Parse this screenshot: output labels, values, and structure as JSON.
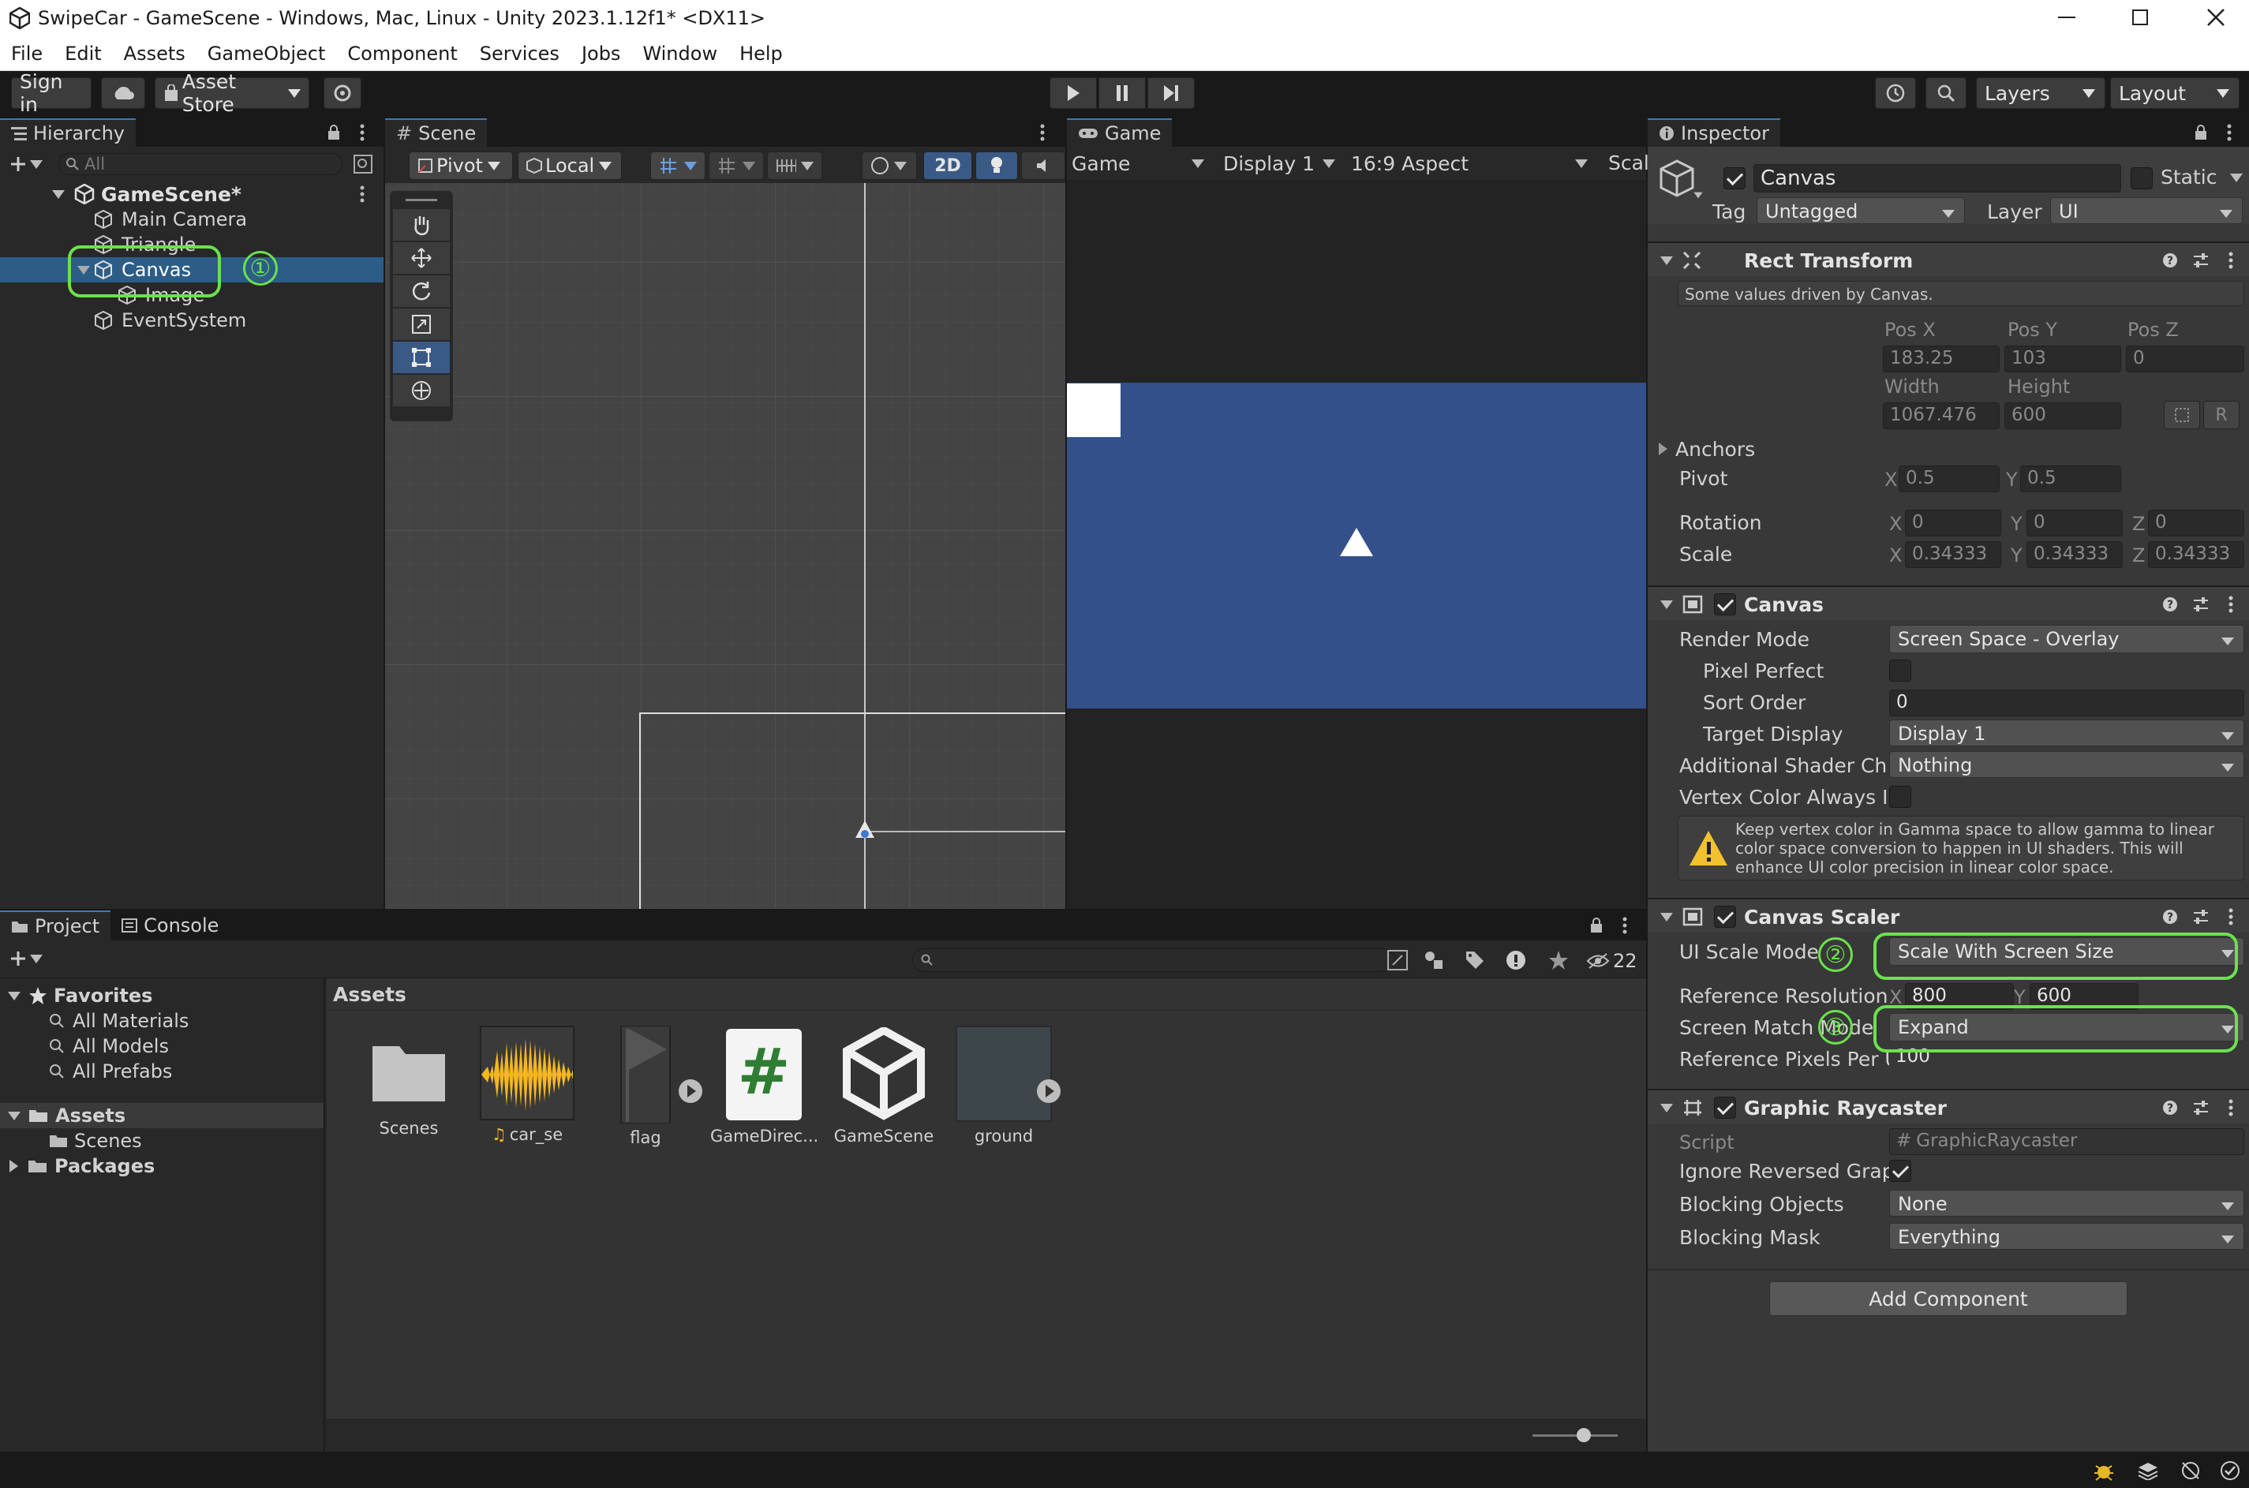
{
  "window": {
    "title": "SwipeCar - GameScene - Windows, Mac, Linux - Unity 2023.1.12f1* <DX11>"
  },
  "menu": [
    "File",
    "Edit",
    "Assets",
    "GameObject",
    "Component",
    "Services",
    "Jobs",
    "Window",
    "Help"
  ],
  "toolbar": {
    "sign_in": "Sign in",
    "asset_store": "Asset Store",
    "layers": "Layers",
    "layout": "Layout"
  },
  "hierarchy": {
    "tab": "Hierarchy",
    "search_placeholder": "All",
    "scene": "GameScene*",
    "items": [
      "Main Camera",
      "Triangle",
      "Canvas",
      "Image",
      "EventSystem"
    ]
  },
  "scene": {
    "tab": "Scene",
    "pivot": "Pivot",
    "local": "Local",
    "mode_2d": "2D"
  },
  "game": {
    "tab": "Game",
    "view": "Game",
    "display": "Display 1",
    "aspect": "16:9 Aspect",
    "scale": "Scal"
  },
  "project": {
    "tabs": [
      "Project",
      "Console"
    ],
    "hidden_count": "22",
    "favorites": "Favorites",
    "favorite_items": [
      "All Materials",
      "All Models",
      "All Prefabs"
    ],
    "assets": "Assets",
    "asset_folders": [
      "Scenes"
    ],
    "packages": "Packages",
    "breadcrumb": "Assets",
    "files": [
      "Scenes",
      "car_se",
      "flag",
      "GameDirec...",
      "GameScene",
      "ground"
    ]
  },
  "inspector": {
    "tab": "Inspector",
    "object_name": "Canvas",
    "static": "Static",
    "tag_label": "Tag",
    "tag": "Untagged",
    "layer_label": "Layer",
    "layer": "UI",
    "rect_transform": {
      "title": "Rect Transform",
      "note": "Some values driven by Canvas.",
      "pos_x_label": "Pos X",
      "pos_y_label": "Pos Y",
      "pos_z_label": "Pos Z",
      "pos_x": "183.25",
      "pos_y": "103",
      "pos_z": "0",
      "width_label": "Width",
      "height_label": "Height",
      "width": "1067.476",
      "height": "600",
      "r_button": "R",
      "anchors": "Anchors",
      "pivot_label": "Pivot",
      "pivot_x": "0.5",
      "pivot_y": "0.5",
      "rotation_label": "Rotation",
      "rot_x": "0",
      "rot_y": "0",
      "rot_z": "0",
      "scale_label": "Scale",
      "scale_x": "0.34333",
      "scale_y": "0.34333",
      "scale_z": "0.34333",
      "x": "X",
      "y": "Y",
      "z": "Z"
    },
    "canvas": {
      "title": "Canvas",
      "render_mode_label": "Render Mode",
      "render_mode": "Screen Space - Overlay",
      "pixel_perfect_label": "Pixel Perfect",
      "sort_order_label": "Sort Order",
      "sort_order": "0",
      "target_display_label": "Target Display",
      "target_display": "Display 1",
      "shader_label": "Additional Shader Char",
      "shader": "Nothing",
      "vertex_label": "Vertex Color Always In",
      "warning": "Keep vertex color in Gamma space to allow gamma to linear color space conversion to happen in UI shaders. This will enhance UI color precision in linear color space."
    },
    "canvas_scaler": {
      "title": "Canvas Scaler",
      "scale_mode_label": "UI Scale Mode",
      "scale_mode": "Scale With Screen Size",
      "ref_res_label": "Reference Resolution",
      "ref_x": "800",
      "ref_y": "600",
      "match_label": "Screen Match Mode",
      "match": "Expand",
      "ppu_label": "Reference Pixels Per Ui",
      "ppu": "100"
    },
    "raycaster": {
      "title": "Graphic Raycaster",
      "script_label": "Script",
      "script": "GraphicRaycaster",
      "ignore_label": "Ignore Reversed Graph",
      "blocking_objects_label": "Blocking Objects",
      "blocking_objects": "None",
      "blocking_mask_label": "Blocking Mask",
      "blocking_mask": "Everything"
    },
    "add_component": "Add Component"
  },
  "annotations": [
    "①",
    "②",
    "③"
  ],
  "colors": {
    "highlight": "#6be14e",
    "game_bg": "#34508a",
    "selection": "#2c5d87"
  }
}
